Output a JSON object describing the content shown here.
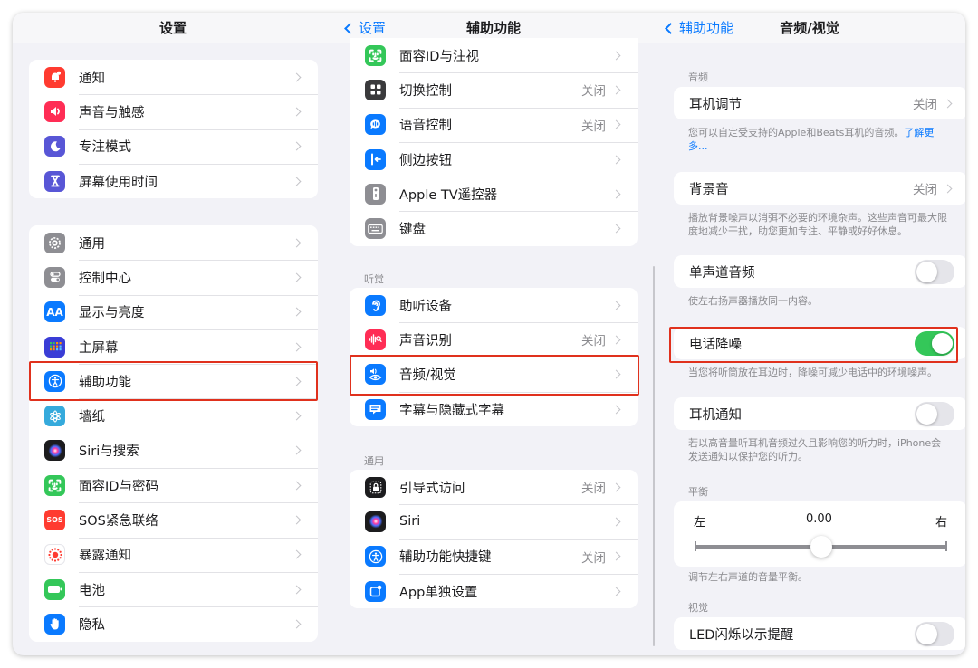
{
  "col1": {
    "title": "设置",
    "group1": [
      {
        "label": "通知",
        "icon": "bell-icon",
        "color": "#ff3b30"
      },
      {
        "label": "声音与触感",
        "icon": "speaker-icon",
        "color": "#ff2d55"
      },
      {
        "label": "专注模式",
        "icon": "moon-icon",
        "color": "#5856d6"
      },
      {
        "label": "屏幕使用时间",
        "icon": "hourglass-icon",
        "color": "#5856d6"
      }
    ],
    "group2": [
      {
        "label": "通用",
        "icon": "gear-icon",
        "color": "#8e8e93"
      },
      {
        "label": "控制中心",
        "icon": "toggles-icon",
        "color": "#8e8e93"
      },
      {
        "label": "显示与亮度",
        "icon": "aa-icon",
        "color": "#0a7aff",
        "glyph": "AA"
      },
      {
        "label": "主屏幕",
        "icon": "homescreen-icon",
        "color": "#3a3dd6"
      },
      {
        "label": "辅助功能",
        "icon": "accessibility-icon",
        "color": "#0a7aff"
      },
      {
        "label": "墙纸",
        "icon": "flower-icon",
        "color": "#35aadc"
      },
      {
        "label": "Siri与搜索",
        "icon": "siri-icon",
        "color": "#1c1c1e"
      },
      {
        "label": "面容ID与密码",
        "icon": "faceid-icon",
        "color": "#34c759"
      },
      {
        "label": "SOS紧急联络",
        "icon": "sos-icon",
        "color": "#ff3b30",
        "glyph": "SOS"
      },
      {
        "label": "暴露通知",
        "icon": "exposure-icon",
        "color": "#ffffff"
      },
      {
        "label": "电池",
        "icon": "battery-icon",
        "color": "#34c759"
      },
      {
        "label": "隐私",
        "icon": "hand-icon",
        "color": "#0a7aff"
      }
    ]
  },
  "col2": {
    "back": "设置",
    "title": "辅助功能",
    "group1": [
      {
        "label": "面容ID与注视",
        "icon": "faceid-icon",
        "color": "#34c759",
        "value": ""
      },
      {
        "label": "切换控制",
        "icon": "switch-control-icon",
        "color": "#3a3a3c",
        "value": "关闭"
      },
      {
        "label": "语音控制",
        "icon": "voice-control-icon",
        "color": "#0a7aff",
        "value": "关闭"
      },
      {
        "label": "侧边按钮",
        "icon": "side-button-icon",
        "color": "#0a7aff",
        "value": ""
      },
      {
        "label": "Apple TV遥控器",
        "icon": "remote-icon",
        "color": "#8e8e93",
        "value": ""
      },
      {
        "label": "键盘",
        "icon": "keyboard-icon",
        "color": "#8e8e93",
        "value": ""
      }
    ],
    "hearing_header": "听觉",
    "group2": [
      {
        "label": "助听设备",
        "icon": "ear-icon",
        "color": "#0a7aff",
        "value": ""
      },
      {
        "label": "声音识别",
        "icon": "sound-recognition-icon",
        "color": "#ff2d55",
        "value": "关闭"
      },
      {
        "label": "音频/视觉",
        "icon": "audio-visual-icon",
        "color": "#0a7aff",
        "value": ""
      },
      {
        "label": "字幕与隐藏式字幕",
        "icon": "captions-icon",
        "color": "#0a7aff",
        "value": ""
      }
    ],
    "general_header": "通用",
    "group3": [
      {
        "label": "引导式访问",
        "icon": "lock-icon",
        "color": "#1c1c1e",
        "value": "关闭"
      },
      {
        "label": "Siri",
        "icon": "siri-icon",
        "color": "#1c1c1e",
        "value": ""
      },
      {
        "label": "辅助功能快捷键",
        "icon": "accessibility-icon",
        "color": "#0a7aff",
        "value": "关闭"
      },
      {
        "label": "App单独设置",
        "icon": "app-settings-icon",
        "color": "#0a7aff",
        "value": ""
      }
    ]
  },
  "col3": {
    "back": "辅助功能",
    "title": "音频/视觉",
    "audio_header": "音频",
    "headphone": {
      "label": "耳机调节",
      "value": "关闭"
    },
    "headphone_note": "您可以自定受支持的Apple和Beats耳机的音频。",
    "headphone_note_link": "了解更多...",
    "background": {
      "label": "背景音",
      "value": "关闭"
    },
    "background_note": "播放背景噪声以消弭不必要的环境杂声。这些声音可最大限度地减少干扰，助您更加专注、平静或好好休息。",
    "mono": {
      "label": "单声道音频",
      "on": false
    },
    "mono_note": "使左右扬声器播放同一内容。",
    "noise_cancel": {
      "label": "电话降噪",
      "on": true
    },
    "noise_cancel_note": "当您将听筒放在耳边时，降噪可减少电话中的环境噪声。",
    "headphone_notify": {
      "label": "耳机通知",
      "on": false
    },
    "headphone_notify_note": "若以高音量听耳机音频过久且影响您的听力时，iPhone会发送通知以保护您的听力。",
    "balance_header": "平衡",
    "balance": {
      "left": "左",
      "right": "右",
      "value_text": "0.00",
      "value": 0.0,
      "min": -1.0,
      "max": 1.0
    },
    "balance_note": "调节左右声道的音量平衡。",
    "visual_header": "视觉",
    "led_flash": {
      "label": "LED闪烁以示提醒",
      "on": false
    }
  },
  "colors": {
    "accent": "#0a7aff",
    "toggle_on": "#34c759",
    "highlight": "#e0311d"
  }
}
